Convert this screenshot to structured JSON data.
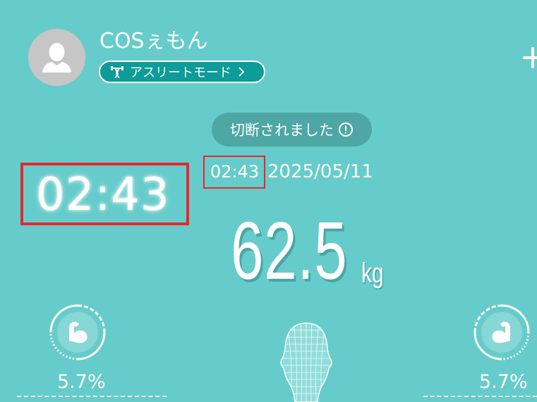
{
  "profile": {
    "username": "COSぇもん",
    "mode_label": "アスリートモード"
  },
  "status": {
    "connection_label": "切断されました"
  },
  "measurement": {
    "time_zoomed": "02:43",
    "time": "02:43",
    "date": "2025/05/11",
    "weight_value": "62.5",
    "weight_unit": "kg"
  },
  "gauges": {
    "left_percent": "5.7%",
    "right_percent": "5.7%"
  },
  "colors": {
    "background": "#66cccb",
    "mode_pill": "#0d9c97",
    "status_pill": "#4ea7a4",
    "highlight": "#e8262e",
    "avatar": "#c6c6c6"
  },
  "icons": {
    "avatar": "person-silhouette-icon",
    "mode": "weightlifter-icon",
    "mode_chevron": "chevron-right-icon",
    "info": "info-circle-icon",
    "add": "plus-icon",
    "left_gauge": "flexed-arm-left-icon",
    "right_gauge": "flexed-arm-right-icon",
    "body_model": "wireframe-head-icon"
  }
}
